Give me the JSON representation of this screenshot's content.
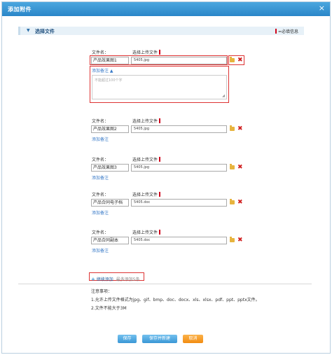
{
  "dialog": {
    "title": "添加附件",
    "close_glyph": "×"
  },
  "section": {
    "caret": "▼",
    "title": "选择文件",
    "required_legend": "=必填信息"
  },
  "labels": {
    "name": "文件名：",
    "file": "选择上传文件"
  },
  "files": [
    {
      "name": "产品效果图1",
      "file": "5405.jpg",
      "note_label": "添加备注 ▲",
      "expanded": true
    },
    {
      "name": "产品效果图2",
      "file": "5405.jpg",
      "note_label": "添加备注"
    },
    {
      "name": "产品效果图3",
      "file": "5405.jpg",
      "note_label": "添加备注"
    },
    {
      "name": "产品合同电子档",
      "file": "5405.doc",
      "note_label": "添加备注"
    },
    {
      "name": "产品合同副本",
      "file": "5405.doc",
      "note_label": "添加备注"
    }
  ],
  "note_placeholder": "不能超过100个字",
  "add_more": {
    "icon": "+",
    "label": "继续添加",
    "limit": "最多添加5条"
  },
  "notice": {
    "title": "注意事项：",
    "line1": "1.允许上传文件格式为jpg、gif、bmp、doc、docx、xls、xlsx、pdf、ppt、pptx文件。",
    "line2": "2.文件不能大于3M"
  },
  "buttons": {
    "save": "保存",
    "save_new": "保存并新建",
    "cancel": "取消"
  },
  "colors": {
    "titlebar": "#2a86c8",
    "required": "#d0021b",
    "link": "#3a7bc8",
    "cancel": "#f28c12",
    "save": "#3a97d6"
  }
}
